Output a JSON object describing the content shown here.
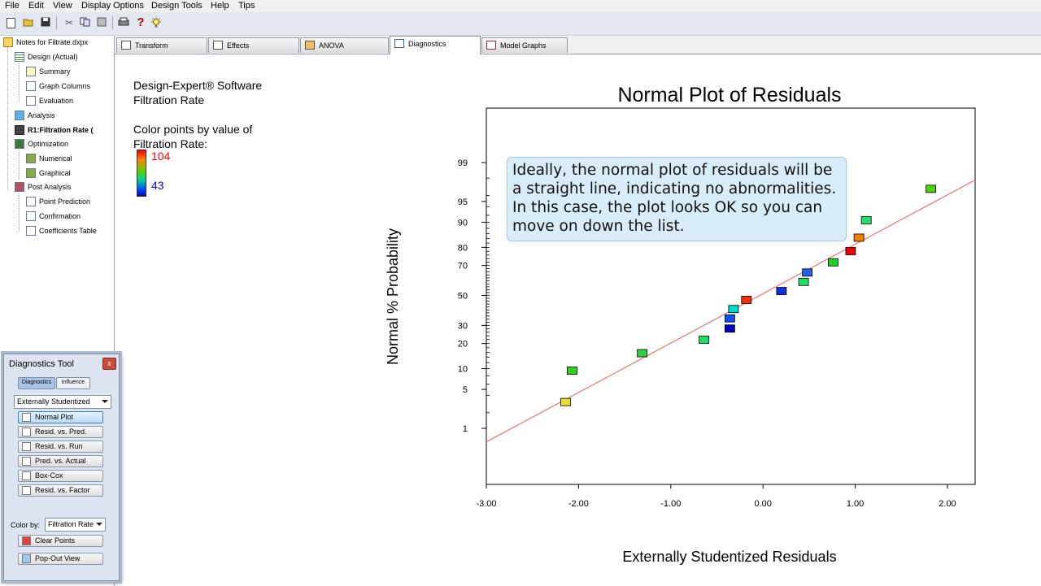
{
  "menubar": {
    "items": [
      "File",
      "Edit",
      "View",
      "Display Options",
      "Design Tools",
      "Help",
      "Tips"
    ]
  },
  "toolbar": {
    "icons": [
      "new-icon",
      "open-icon",
      "save-icon",
      "cut-icon",
      "copy-icon",
      "paste-icon",
      "print-icon",
      "help-icon",
      "tip-icon"
    ],
    "help_glyph": "?"
  },
  "tree": {
    "root": "Notes for Filtrate.dxpx",
    "design": "Design (Actual)",
    "summary": "Summary",
    "graph_columns": "Graph Columns",
    "evaluation": "Evaluation",
    "analysis": "Analysis",
    "r1": "R1:Filtration Rate (",
    "optimization": "Optimization",
    "numerical": "Numerical",
    "graphical": "Graphical",
    "post_analysis": "Post Analysis",
    "point_prediction": "Point Prediction",
    "confirmation": "Confirmation",
    "coefficients_table": "Coefficients Table"
  },
  "tabs": [
    "Transform",
    "Effects",
    "ANOVA",
    "Diagnostics",
    "Model Graphs"
  ],
  "active_tab": "Diagnostics",
  "info": {
    "software": "Design-Expert® Software",
    "response": "Filtration Rate",
    "color_line1": "Color points by value of",
    "color_line2": "Filtration Rate:",
    "legend_high": "104",
    "legend_low": "43",
    "legend_high_color": "#ff0000",
    "legend_low_color": "#0000ff"
  },
  "callout": {
    "text": "Ideally, the normal plot of residuals will be\na straight line, indicating no abnormalities.\nIn this case, the plot looks OK so you can\nmove on down the list."
  },
  "diagnostics_tool": {
    "title": "Diagnostics Tool",
    "close_glyph": "x",
    "mode_diagnostics": "Diagnostics",
    "mode_influence": "Influence",
    "residual_type": "Externally Studentized",
    "buttons": [
      "Normal Plot",
      "Resid. vs. Pred.",
      "Resid. vs. Run",
      "Pred. vs. Actual",
      "Box-Cox",
      "Resid. vs. Factor"
    ],
    "active_button": "Normal Plot",
    "color_by_label": "Color by:",
    "color_by_value": "Filtration Rate",
    "clear_points": "Clear Points",
    "pop_out": "Pop-Out View"
  },
  "chart_data": {
    "type": "scatter",
    "title": "Normal Plot of Residuals",
    "xlabel": "Externally Studentized Residuals",
    "ylabel": "Normal % Probability",
    "xlim": [
      -3.0,
      2.3
    ],
    "x_ticks": [
      -3.0,
      -2.0,
      -1.0,
      0.0,
      1.0,
      2.0
    ],
    "x_tick_labels": [
      "-3.00",
      "-2.00",
      "-1.00",
      "0.00",
      "1.00",
      "2.00"
    ],
    "y_ticks": [
      1,
      5,
      10,
      20,
      30,
      50,
      70,
      80,
      90,
      95,
      99
    ],
    "y_tick_labels": [
      "1",
      "5",
      "10",
      "20",
      "30",
      "50",
      "70",
      "80",
      "90",
      "95",
      "99"
    ],
    "y_scale": "normal probability",
    "fit_line": {
      "color": "#f07070"
    },
    "points": [
      {
        "x": -2.14,
        "y": 3.1,
        "color": "#e8e030"
      },
      {
        "x": -2.07,
        "y": 9.4,
        "color": "#30d020"
      },
      {
        "x": -1.31,
        "y": 15.6,
        "color": "#30d040"
      },
      {
        "x": -0.64,
        "y": 21.9,
        "color": "#20e060"
      },
      {
        "x": -0.36,
        "y": 28.1,
        "color": "#0000c0"
      },
      {
        "x": -0.36,
        "y": 34.4,
        "color": "#1050f0"
      },
      {
        "x": -0.32,
        "y": 40.6,
        "color": "#00d8d0"
      },
      {
        "x": -0.18,
        "y": 46.9,
        "color": "#f03000"
      },
      {
        "x": 0.2,
        "y": 53.1,
        "color": "#1030e0"
      },
      {
        "x": 0.44,
        "y": 59.4,
        "color": "#20e060"
      },
      {
        "x": 0.48,
        "y": 65.6,
        "color": "#2060f0"
      },
      {
        "x": 0.76,
        "y": 71.9,
        "color": "#20d020"
      },
      {
        "x": 0.95,
        "y": 78.1,
        "color": "#f00000"
      },
      {
        "x": 1.04,
        "y": 84.4,
        "color": "#f08000"
      },
      {
        "x": 1.12,
        "y": 90.6,
        "color": "#20e070"
      },
      {
        "x": 1.82,
        "y": 96.9,
        "color": "#50d000"
      }
    ]
  }
}
